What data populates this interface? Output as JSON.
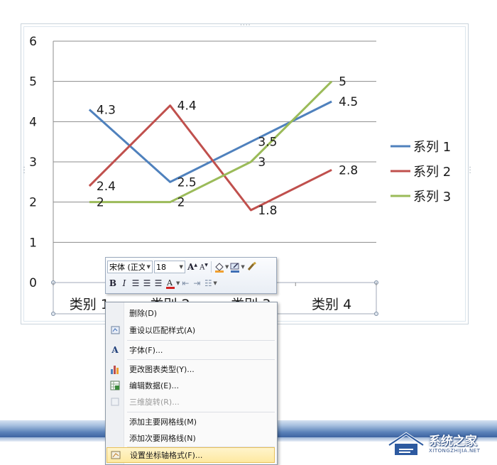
{
  "chart_data": {
    "type": "line",
    "categories": [
      "类别 1",
      "类别 2",
      "类别 3",
      "类别 4"
    ],
    "series": [
      {
        "name": "系列 1",
        "values": [
          4.3,
          2.5,
          3.5,
          4.5
        ],
        "color": "#4f81bd"
      },
      {
        "name": "系列 2",
        "values": [
          2.4,
          4.4,
          1.8,
          2.8
        ],
        "color": "#c0504d"
      },
      {
        "name": "系列 3",
        "values": [
          2,
          2,
          3,
          5
        ],
        "color": "#9bbb59"
      }
    ],
    "y_ticks": [
      "0",
      "1",
      "2",
      "3",
      "4",
      "5",
      "6"
    ],
    "ylim": [
      0,
      6
    ],
    "grid": true,
    "data_labels": true,
    "legend_position": "right"
  },
  "mini_toolbar": {
    "font_name": "宋体 (正文",
    "font_size": "18",
    "bold": "B",
    "italic": "I"
  },
  "context_menu": {
    "items": [
      {
        "label": "删除(D)",
        "icon": "delete-icon",
        "enabled": true
      },
      {
        "label": "重设以匹配样式(A)",
        "icon": "reset-style-icon",
        "enabled": true
      },
      {
        "label": "字体(F)...",
        "icon": "font-icon",
        "enabled": true
      },
      {
        "label": "更改图表类型(Y)...",
        "icon": "chart-type-icon",
        "enabled": true
      },
      {
        "label": "编辑数据(E)...",
        "icon": "edit-data-icon",
        "enabled": true
      },
      {
        "label": "三维旋转(R)...",
        "icon": "3d-rotation-icon",
        "enabled": false
      },
      {
        "label": "添加主要网格线(M)",
        "icon": "",
        "enabled": true
      },
      {
        "label": "添加次要网格线(N)",
        "icon": "",
        "enabled": true
      },
      {
        "label": "设置坐标轴格式(F)...",
        "icon": "format-axis-icon",
        "enabled": true,
        "highlighted": true
      }
    ]
  },
  "watermark": {
    "title": "系统之家",
    "subtitle": "XITONGZHIJIA.NET"
  },
  "colors": {
    "accent_highlight": "#fde9a1",
    "band_blue": "#3d64a1"
  }
}
